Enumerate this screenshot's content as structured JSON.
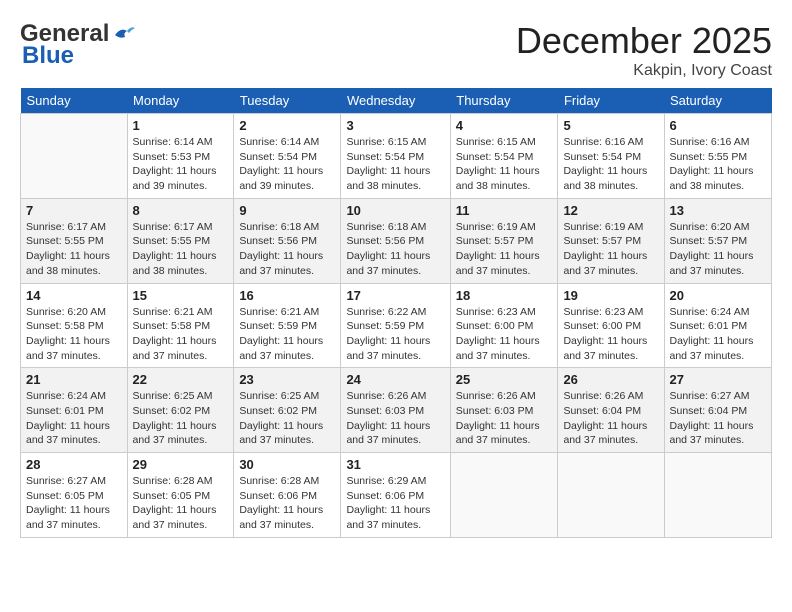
{
  "logo": {
    "general": "General",
    "blue": "Blue"
  },
  "title": "December 2025",
  "subtitle": "Kakpin, Ivory Coast",
  "headers": [
    "Sunday",
    "Monday",
    "Tuesday",
    "Wednesday",
    "Thursday",
    "Friday",
    "Saturday"
  ],
  "weeks": [
    [
      {
        "num": "",
        "sunrise": "",
        "sunset": "",
        "daylight": ""
      },
      {
        "num": "1",
        "sunrise": "Sunrise: 6:14 AM",
        "sunset": "Sunset: 5:53 PM",
        "daylight": "Daylight: 11 hours and 39 minutes."
      },
      {
        "num": "2",
        "sunrise": "Sunrise: 6:14 AM",
        "sunset": "Sunset: 5:54 PM",
        "daylight": "Daylight: 11 hours and 39 minutes."
      },
      {
        "num": "3",
        "sunrise": "Sunrise: 6:15 AM",
        "sunset": "Sunset: 5:54 PM",
        "daylight": "Daylight: 11 hours and 38 minutes."
      },
      {
        "num": "4",
        "sunrise": "Sunrise: 6:15 AM",
        "sunset": "Sunset: 5:54 PM",
        "daylight": "Daylight: 11 hours and 38 minutes."
      },
      {
        "num": "5",
        "sunrise": "Sunrise: 6:16 AM",
        "sunset": "Sunset: 5:54 PM",
        "daylight": "Daylight: 11 hours and 38 minutes."
      },
      {
        "num": "6",
        "sunrise": "Sunrise: 6:16 AM",
        "sunset": "Sunset: 5:55 PM",
        "daylight": "Daylight: 11 hours and 38 minutes."
      }
    ],
    [
      {
        "num": "7",
        "sunrise": "Sunrise: 6:17 AM",
        "sunset": "Sunset: 5:55 PM",
        "daylight": "Daylight: 11 hours and 38 minutes."
      },
      {
        "num": "8",
        "sunrise": "Sunrise: 6:17 AM",
        "sunset": "Sunset: 5:55 PM",
        "daylight": "Daylight: 11 hours and 38 minutes."
      },
      {
        "num": "9",
        "sunrise": "Sunrise: 6:18 AM",
        "sunset": "Sunset: 5:56 PM",
        "daylight": "Daylight: 11 hours and 37 minutes."
      },
      {
        "num": "10",
        "sunrise": "Sunrise: 6:18 AM",
        "sunset": "Sunset: 5:56 PM",
        "daylight": "Daylight: 11 hours and 37 minutes."
      },
      {
        "num": "11",
        "sunrise": "Sunrise: 6:19 AM",
        "sunset": "Sunset: 5:57 PM",
        "daylight": "Daylight: 11 hours and 37 minutes."
      },
      {
        "num": "12",
        "sunrise": "Sunrise: 6:19 AM",
        "sunset": "Sunset: 5:57 PM",
        "daylight": "Daylight: 11 hours and 37 minutes."
      },
      {
        "num": "13",
        "sunrise": "Sunrise: 6:20 AM",
        "sunset": "Sunset: 5:57 PM",
        "daylight": "Daylight: 11 hours and 37 minutes."
      }
    ],
    [
      {
        "num": "14",
        "sunrise": "Sunrise: 6:20 AM",
        "sunset": "Sunset: 5:58 PM",
        "daylight": "Daylight: 11 hours and 37 minutes."
      },
      {
        "num": "15",
        "sunrise": "Sunrise: 6:21 AM",
        "sunset": "Sunset: 5:58 PM",
        "daylight": "Daylight: 11 hours and 37 minutes."
      },
      {
        "num": "16",
        "sunrise": "Sunrise: 6:21 AM",
        "sunset": "Sunset: 5:59 PM",
        "daylight": "Daylight: 11 hours and 37 minutes."
      },
      {
        "num": "17",
        "sunrise": "Sunrise: 6:22 AM",
        "sunset": "Sunset: 5:59 PM",
        "daylight": "Daylight: 11 hours and 37 minutes."
      },
      {
        "num": "18",
        "sunrise": "Sunrise: 6:23 AM",
        "sunset": "Sunset: 6:00 PM",
        "daylight": "Daylight: 11 hours and 37 minutes."
      },
      {
        "num": "19",
        "sunrise": "Sunrise: 6:23 AM",
        "sunset": "Sunset: 6:00 PM",
        "daylight": "Daylight: 11 hours and 37 minutes."
      },
      {
        "num": "20",
        "sunrise": "Sunrise: 6:24 AM",
        "sunset": "Sunset: 6:01 PM",
        "daylight": "Daylight: 11 hours and 37 minutes."
      }
    ],
    [
      {
        "num": "21",
        "sunrise": "Sunrise: 6:24 AM",
        "sunset": "Sunset: 6:01 PM",
        "daylight": "Daylight: 11 hours and 37 minutes."
      },
      {
        "num": "22",
        "sunrise": "Sunrise: 6:25 AM",
        "sunset": "Sunset: 6:02 PM",
        "daylight": "Daylight: 11 hours and 37 minutes."
      },
      {
        "num": "23",
        "sunrise": "Sunrise: 6:25 AM",
        "sunset": "Sunset: 6:02 PM",
        "daylight": "Daylight: 11 hours and 37 minutes."
      },
      {
        "num": "24",
        "sunrise": "Sunrise: 6:26 AM",
        "sunset": "Sunset: 6:03 PM",
        "daylight": "Daylight: 11 hours and 37 minutes."
      },
      {
        "num": "25",
        "sunrise": "Sunrise: 6:26 AM",
        "sunset": "Sunset: 6:03 PM",
        "daylight": "Daylight: 11 hours and 37 minutes."
      },
      {
        "num": "26",
        "sunrise": "Sunrise: 6:26 AM",
        "sunset": "Sunset: 6:04 PM",
        "daylight": "Daylight: 11 hours and 37 minutes."
      },
      {
        "num": "27",
        "sunrise": "Sunrise: 6:27 AM",
        "sunset": "Sunset: 6:04 PM",
        "daylight": "Daylight: 11 hours and 37 minutes."
      }
    ],
    [
      {
        "num": "28",
        "sunrise": "Sunrise: 6:27 AM",
        "sunset": "Sunset: 6:05 PM",
        "daylight": "Daylight: 11 hours and 37 minutes."
      },
      {
        "num": "29",
        "sunrise": "Sunrise: 6:28 AM",
        "sunset": "Sunset: 6:05 PM",
        "daylight": "Daylight: 11 hours and 37 minutes."
      },
      {
        "num": "30",
        "sunrise": "Sunrise: 6:28 AM",
        "sunset": "Sunset: 6:06 PM",
        "daylight": "Daylight: 11 hours and 37 minutes."
      },
      {
        "num": "31",
        "sunrise": "Sunrise: 6:29 AM",
        "sunset": "Sunset: 6:06 PM",
        "daylight": "Daylight: 11 hours and 37 minutes."
      },
      {
        "num": "",
        "sunrise": "",
        "sunset": "",
        "daylight": ""
      },
      {
        "num": "",
        "sunrise": "",
        "sunset": "",
        "daylight": ""
      },
      {
        "num": "",
        "sunrise": "",
        "sunset": "",
        "daylight": ""
      }
    ]
  ]
}
